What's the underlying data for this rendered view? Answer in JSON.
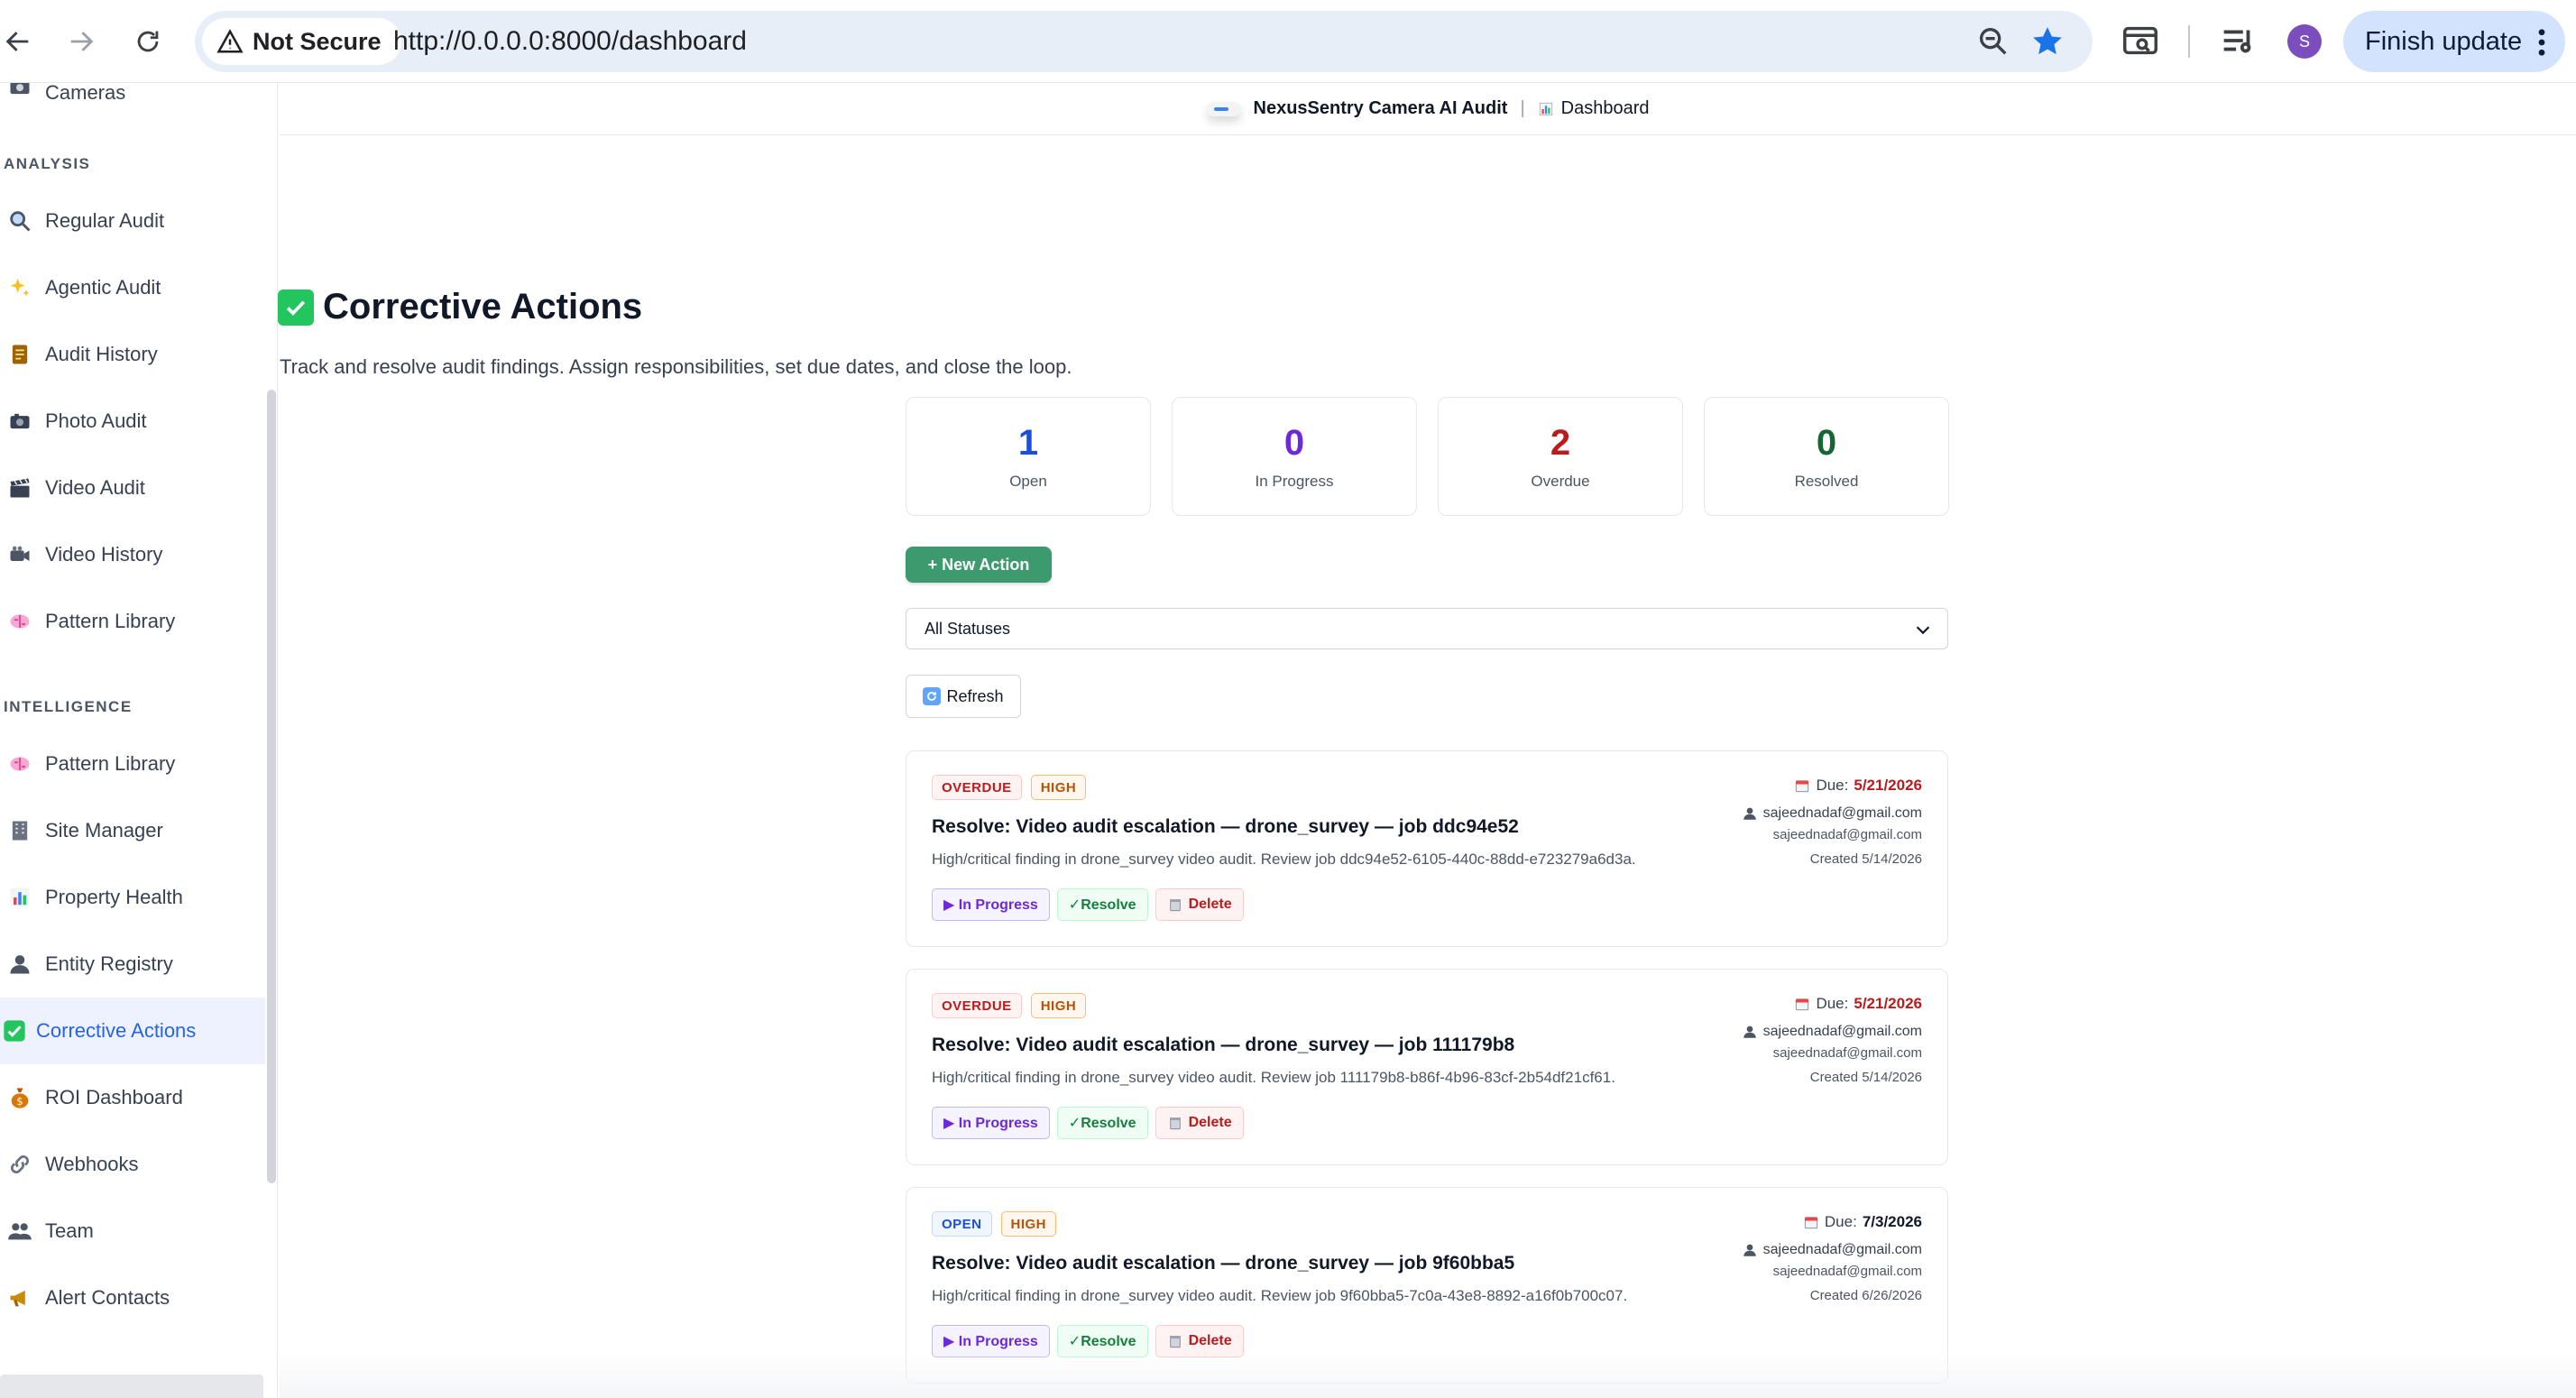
{
  "browser": {
    "security_label": "Not Secure",
    "url": "http://0.0.0.0:8000/dashboard",
    "avatar_letter": "S",
    "finish_update_label": "Finish update"
  },
  "header": {
    "brand": "NexusSentry Camera AI Audit",
    "separator": "|",
    "page": "Dashboard"
  },
  "sidebar": {
    "top_partial": "Cameras",
    "sections": [
      {
        "title": "ANALYSIS",
        "items": [
          {
            "label": "Regular Audit",
            "icon": "magnifier-icon"
          },
          {
            "label": "Agentic Audit",
            "icon": "sparkles-icon"
          },
          {
            "label": "Audit History",
            "icon": "scroll-icon"
          },
          {
            "label": "Photo Audit",
            "icon": "camera-icon"
          },
          {
            "label": "Video Audit",
            "icon": "clapper-icon"
          },
          {
            "label": "Video History",
            "icon": "video-camera-icon"
          },
          {
            "label": "Pattern Library",
            "icon": "brain-icon"
          }
        ]
      },
      {
        "title": "INTELLIGENCE",
        "items": [
          {
            "label": "Pattern Library",
            "icon": "brain-icon"
          },
          {
            "label": "Site Manager",
            "icon": "building-icon"
          },
          {
            "label": "Property Health",
            "icon": "bar-chart-icon"
          },
          {
            "label": "Entity Registry",
            "icon": "person-icon"
          },
          {
            "label": "Corrective Actions",
            "icon": "check-box-icon",
            "active": true
          },
          {
            "label": "ROI Dashboard",
            "icon": "money-bag-icon"
          },
          {
            "label": "Webhooks",
            "icon": "link-icon"
          },
          {
            "label": "Team",
            "icon": "people-icon"
          },
          {
            "label": "Alert Contacts",
            "icon": "megaphone-icon"
          }
        ]
      }
    ]
  },
  "page": {
    "title": "Corrective Actions",
    "subtitle": "Track and resolve audit findings. Assign responsibilities, set due dates, and close the loop.",
    "stats": [
      {
        "value": "1",
        "label": "Open",
        "color": "#1d4ed8"
      },
      {
        "value": "0",
        "label": "In Progress",
        "color": "#6d28d9"
      },
      {
        "value": "2",
        "label": "Overdue",
        "color": "#b91c1c"
      },
      {
        "value": "0",
        "label": "Resolved",
        "color": "#166534"
      }
    ],
    "new_action_label": "+ New Action",
    "status_filter": "All Statuses",
    "refresh_label": "Refresh",
    "actions": [
      {
        "status": "OVERDUE",
        "priority": "HIGH",
        "title": "Resolve: Video audit escalation — drone_survey — job ddc94e52",
        "description": "High/critical finding in drone_survey video audit. Review job ddc94e52-6105-440c-88dd-e723279a6d3a.",
        "due_label": "Due:",
        "due_date": "5/21/2026",
        "assignee": "sajeednadaf@gmail.com",
        "assigned_by": "sajeednadaf@gmail.com",
        "created": "Created 5/14/2026",
        "btn_progress": "▶ In Progress",
        "btn_resolve": "✓Resolve",
        "btn_delete": "Delete"
      },
      {
        "status": "OVERDUE",
        "priority": "HIGH",
        "title": "Resolve: Video audit escalation — drone_survey — job 111179b8",
        "description": "High/critical finding in drone_survey video audit. Review job 111179b8-b86f-4b96-83cf-2b54df21cf61.",
        "due_label": "Due:",
        "due_date": "5/21/2026",
        "assignee": "sajeednadaf@gmail.com",
        "assigned_by": "sajeednadaf@gmail.com",
        "created": "Created 5/14/2026",
        "btn_progress": "▶ In Progress",
        "btn_resolve": "✓Resolve",
        "btn_delete": "Delete"
      },
      {
        "status": "OPEN",
        "priority": "HIGH",
        "title": "Resolve: Video audit escalation — drone_survey — job 9f60bba5",
        "description": "High/critical finding in drone_survey video audit. Review job 9f60bba5-7c0a-43e8-8892-a16f0b700c07.",
        "due_label": "Due:",
        "due_date": "7/3/2026",
        "assignee": "sajeednadaf@gmail.com",
        "assigned_by": "sajeednadaf@gmail.com",
        "created": "Created 6/26/2026",
        "btn_progress": "▶ In Progress",
        "btn_resolve": "✓Resolve",
        "btn_delete": "Delete"
      }
    ]
  },
  "colors": {
    "accent": "#2563eb",
    "success": "#3d9a6e",
    "danger": "#b91c1c"
  }
}
